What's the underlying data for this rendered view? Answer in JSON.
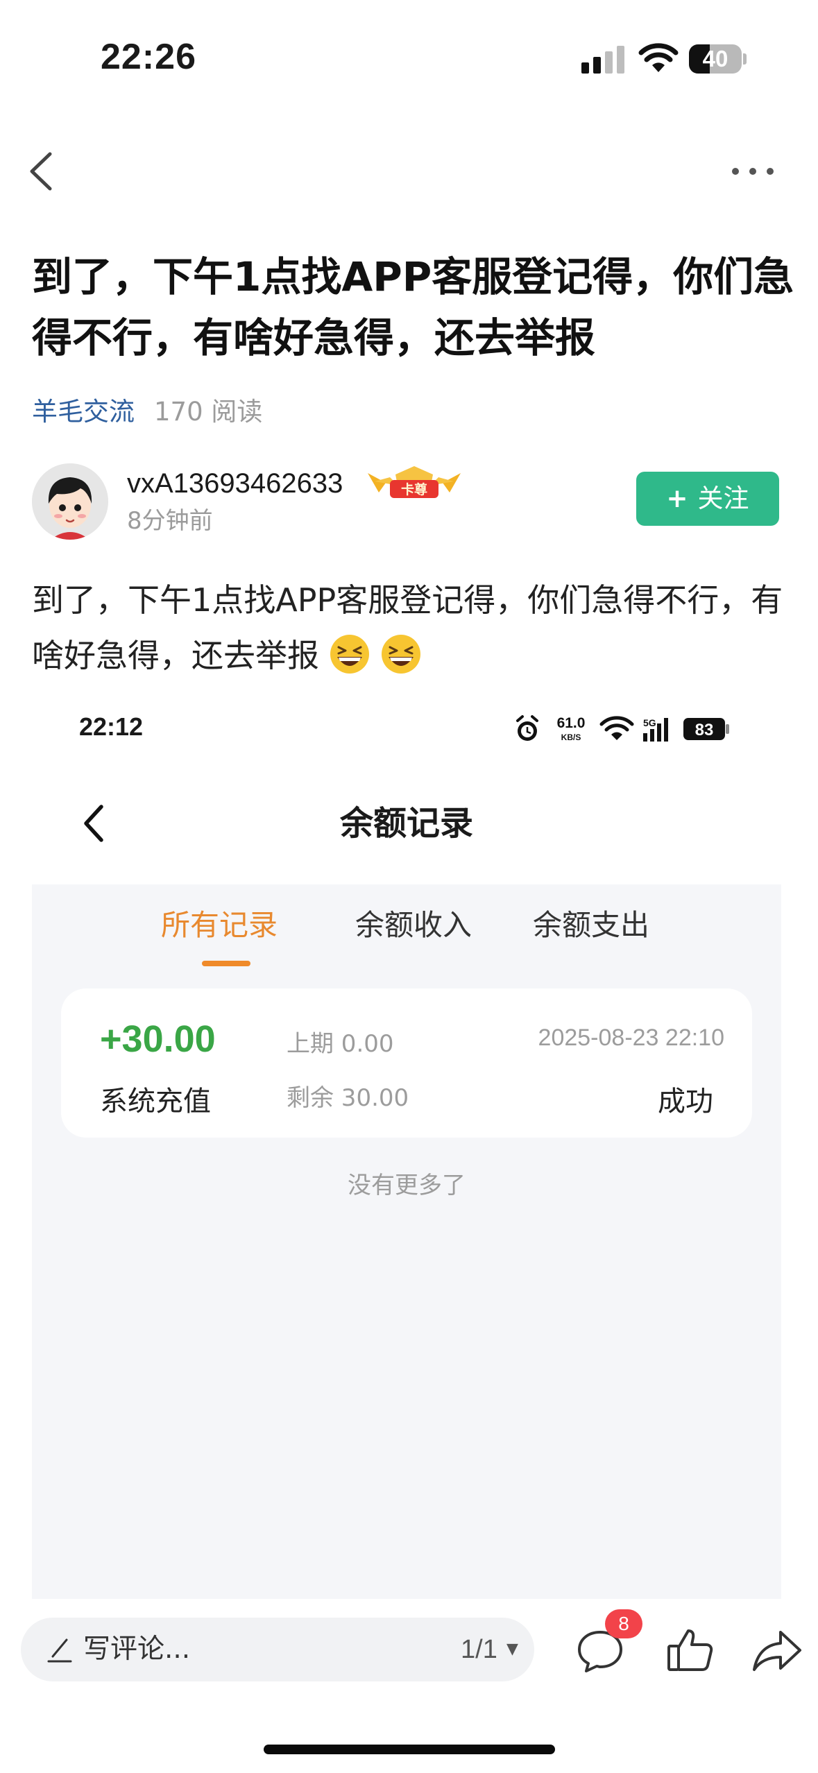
{
  "status_bar": {
    "time": "22:26",
    "battery": "40",
    "battery_level": 0.4
  },
  "post": {
    "title": "到了，下午1点找APP客服登记得，你们急得不行，有啥好急得，还去举报",
    "category": "羊毛交流",
    "reads": "170 阅读",
    "author_name": "vxA13693462633",
    "badge_text": "卡尊",
    "posted_ago": "8分钟前",
    "follow_label": "关注",
    "body": "到了，下午1点找APP客服登记得，你们急得不行，有啥好急得，还去举报"
  },
  "embedded": {
    "time": "22:12",
    "net_speed_value": "61.0",
    "net_speed_unit": "KB/S",
    "network": "5G",
    "battery": "83",
    "title": "余额记录",
    "tabs": [
      "所有记录",
      "余额收入",
      "余额支出"
    ],
    "active_tab": 0,
    "record": {
      "amount": "+30.00",
      "type": "系统充值",
      "previous": "上期 0.00",
      "remaining": "剩余 30.00",
      "date": "2025-08-23 22:10",
      "status": "成功"
    },
    "no_more": "没有更多了"
  },
  "bottom_bar": {
    "comment_placeholder": "写评论...",
    "page_indicator": "1/1",
    "comment_count": "8"
  },
  "colors": {
    "category_link": "#2f5f9e",
    "follow_button": "#2fb98a",
    "active_tab": "#e8892f",
    "amount_green": "#3aa646",
    "badge_red": "#f2434a"
  }
}
